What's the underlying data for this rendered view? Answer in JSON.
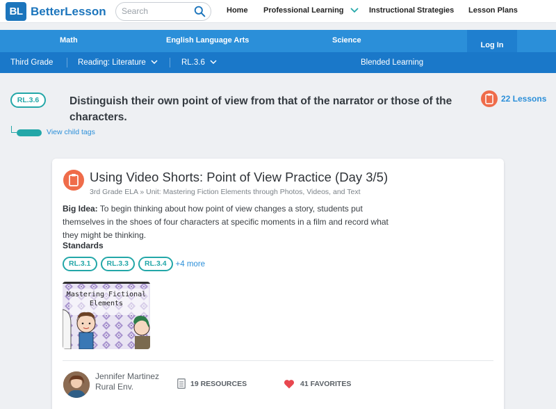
{
  "brand": {
    "badge": "BL",
    "name": "BetterLesson"
  },
  "search": {
    "placeholder": "Search"
  },
  "topnav": [
    {
      "label": "Home"
    },
    {
      "label": "Professional Learning"
    },
    {
      "label": "Instructional Strategies"
    },
    {
      "label": "Lesson Plans"
    }
  ],
  "subjects": [
    {
      "label": "Math"
    },
    {
      "label": "English Language Arts"
    },
    {
      "label": "Science"
    }
  ],
  "login": "Log In",
  "gradebar": {
    "grade": "Third Grade",
    "strand": "Reading: Literature",
    "standard": "RL.3.6",
    "blended": "Blended Learning"
  },
  "standard": {
    "code": "RL.3.6",
    "title": "Distinguish their own point of view from that of the narrator or those of the characters.",
    "lessons": "22 Lessons",
    "child_link": "View child tags"
  },
  "lesson": {
    "title": "Using Video Shorts: Point of View Practice (Day 3/5)",
    "subtitle": "3rd Grade ELA » Unit: Mastering Fiction Elements through Photos, Videos, and Text",
    "big_idea_label": "Big Idea:",
    "big_idea": "To begin thinking about how point of view changes a story, students put themselves in the shoes of four characters at specific moments in a film and record what they might be thinking.",
    "standards_label": "Standards",
    "tags": [
      "RL.3.1",
      "RL.3.3",
      "RL.3.4"
    ],
    "more": "+4 more",
    "thumb_text_1": "Mastering Fictional",
    "thumb_text_2": "Elements",
    "author_name": "Jennifer Martinez",
    "author_school": "Rural Env.",
    "resources": "19 RESOURCES",
    "favorites": "41 FAVORITES"
  },
  "colors": {
    "brand_blue": "#1c75bc",
    "subject_bar": "#2b8fd9",
    "grade_bar": "#1a78c9",
    "teal": "#23a7a8",
    "orange": "#ef6c4a",
    "heart": "#e8474f"
  },
  "icons": [
    "search-icon",
    "chevron-down-icon",
    "clipboard-icon",
    "document-icon",
    "heart-icon"
  ]
}
